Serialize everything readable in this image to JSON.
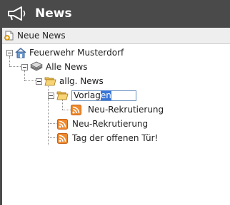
{
  "header": {
    "title": "News",
    "icon": "megaphone-icon"
  },
  "toolbar": {
    "new_news_label": "Neue News",
    "icon": "new-document-icon"
  },
  "tree": {
    "root": "Feuerwehr Musterdorf",
    "all_news": "Alle News",
    "category": "allg. News",
    "editing": {
      "value_before": "Vorlag",
      "selected": "en"
    },
    "template_item": "Neu-Rekrutierung",
    "items": [
      "Neu-Rekrutierung",
      "Tag der offenen Tür!"
    ]
  },
  "colors": {
    "header_bg": "#4a4a4a",
    "panel_bg": "#ffffff",
    "selection": "#3875d7",
    "rss": "#f0892c"
  }
}
